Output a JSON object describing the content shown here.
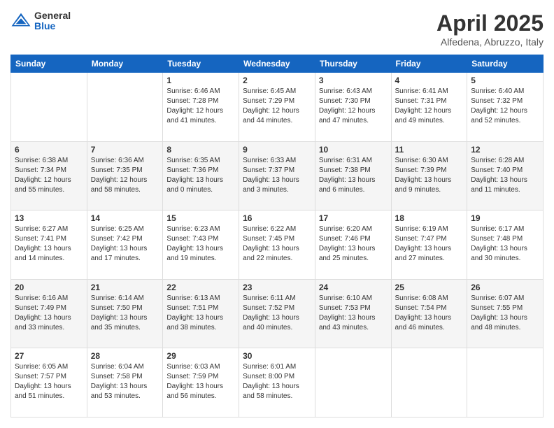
{
  "header": {
    "logo": {
      "general": "General",
      "blue": "Blue"
    },
    "title": "April 2025",
    "location": "Alfedena, Abruzzo, Italy"
  },
  "weekdays": [
    "Sunday",
    "Monday",
    "Tuesday",
    "Wednesday",
    "Thursday",
    "Friday",
    "Saturday"
  ],
  "weeks": [
    [
      {
        "day": "",
        "info": ""
      },
      {
        "day": "",
        "info": ""
      },
      {
        "day": "1",
        "info": "Sunrise: 6:46 AM\nSunset: 7:28 PM\nDaylight: 12 hours and 41 minutes."
      },
      {
        "day": "2",
        "info": "Sunrise: 6:45 AM\nSunset: 7:29 PM\nDaylight: 12 hours and 44 minutes."
      },
      {
        "day": "3",
        "info": "Sunrise: 6:43 AM\nSunset: 7:30 PM\nDaylight: 12 hours and 47 minutes."
      },
      {
        "day": "4",
        "info": "Sunrise: 6:41 AM\nSunset: 7:31 PM\nDaylight: 12 hours and 49 minutes."
      },
      {
        "day": "5",
        "info": "Sunrise: 6:40 AM\nSunset: 7:32 PM\nDaylight: 12 hours and 52 minutes."
      }
    ],
    [
      {
        "day": "6",
        "info": "Sunrise: 6:38 AM\nSunset: 7:34 PM\nDaylight: 12 hours and 55 minutes."
      },
      {
        "day": "7",
        "info": "Sunrise: 6:36 AM\nSunset: 7:35 PM\nDaylight: 12 hours and 58 minutes."
      },
      {
        "day": "8",
        "info": "Sunrise: 6:35 AM\nSunset: 7:36 PM\nDaylight: 13 hours and 0 minutes."
      },
      {
        "day": "9",
        "info": "Sunrise: 6:33 AM\nSunset: 7:37 PM\nDaylight: 13 hours and 3 minutes."
      },
      {
        "day": "10",
        "info": "Sunrise: 6:31 AM\nSunset: 7:38 PM\nDaylight: 13 hours and 6 minutes."
      },
      {
        "day": "11",
        "info": "Sunrise: 6:30 AM\nSunset: 7:39 PM\nDaylight: 13 hours and 9 minutes."
      },
      {
        "day": "12",
        "info": "Sunrise: 6:28 AM\nSunset: 7:40 PM\nDaylight: 13 hours and 11 minutes."
      }
    ],
    [
      {
        "day": "13",
        "info": "Sunrise: 6:27 AM\nSunset: 7:41 PM\nDaylight: 13 hours and 14 minutes."
      },
      {
        "day": "14",
        "info": "Sunrise: 6:25 AM\nSunset: 7:42 PM\nDaylight: 13 hours and 17 minutes."
      },
      {
        "day": "15",
        "info": "Sunrise: 6:23 AM\nSunset: 7:43 PM\nDaylight: 13 hours and 19 minutes."
      },
      {
        "day": "16",
        "info": "Sunrise: 6:22 AM\nSunset: 7:45 PM\nDaylight: 13 hours and 22 minutes."
      },
      {
        "day": "17",
        "info": "Sunrise: 6:20 AM\nSunset: 7:46 PM\nDaylight: 13 hours and 25 minutes."
      },
      {
        "day": "18",
        "info": "Sunrise: 6:19 AM\nSunset: 7:47 PM\nDaylight: 13 hours and 27 minutes."
      },
      {
        "day": "19",
        "info": "Sunrise: 6:17 AM\nSunset: 7:48 PM\nDaylight: 13 hours and 30 minutes."
      }
    ],
    [
      {
        "day": "20",
        "info": "Sunrise: 6:16 AM\nSunset: 7:49 PM\nDaylight: 13 hours and 33 minutes."
      },
      {
        "day": "21",
        "info": "Sunrise: 6:14 AM\nSunset: 7:50 PM\nDaylight: 13 hours and 35 minutes."
      },
      {
        "day": "22",
        "info": "Sunrise: 6:13 AM\nSunset: 7:51 PM\nDaylight: 13 hours and 38 minutes."
      },
      {
        "day": "23",
        "info": "Sunrise: 6:11 AM\nSunset: 7:52 PM\nDaylight: 13 hours and 40 minutes."
      },
      {
        "day": "24",
        "info": "Sunrise: 6:10 AM\nSunset: 7:53 PM\nDaylight: 13 hours and 43 minutes."
      },
      {
        "day": "25",
        "info": "Sunrise: 6:08 AM\nSunset: 7:54 PM\nDaylight: 13 hours and 46 minutes."
      },
      {
        "day": "26",
        "info": "Sunrise: 6:07 AM\nSunset: 7:55 PM\nDaylight: 13 hours and 48 minutes."
      }
    ],
    [
      {
        "day": "27",
        "info": "Sunrise: 6:05 AM\nSunset: 7:57 PM\nDaylight: 13 hours and 51 minutes."
      },
      {
        "day": "28",
        "info": "Sunrise: 6:04 AM\nSunset: 7:58 PM\nDaylight: 13 hours and 53 minutes."
      },
      {
        "day": "29",
        "info": "Sunrise: 6:03 AM\nSunset: 7:59 PM\nDaylight: 13 hours and 56 minutes."
      },
      {
        "day": "30",
        "info": "Sunrise: 6:01 AM\nSunset: 8:00 PM\nDaylight: 13 hours and 58 minutes."
      },
      {
        "day": "",
        "info": ""
      },
      {
        "day": "",
        "info": ""
      },
      {
        "day": "",
        "info": ""
      }
    ]
  ]
}
